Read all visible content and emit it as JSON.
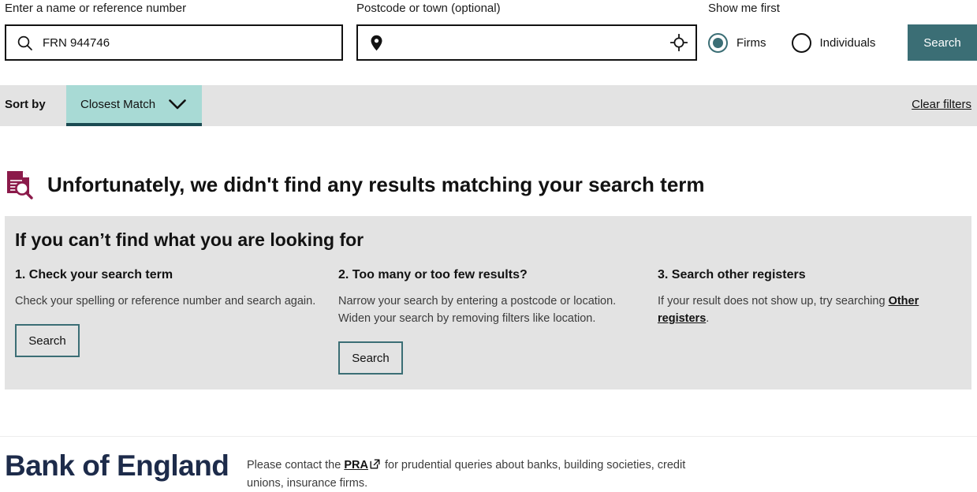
{
  "search_bar": {
    "name_field": {
      "label": "Enter a name or reference number",
      "value": "FRN 944746",
      "placeholder": "",
      "icon": "search-icon"
    },
    "postcode_field": {
      "label": "Postcode or town (optional)",
      "value": "",
      "placeholder": "",
      "left_icon": "map-pin-icon",
      "right_icon": "locate-crosshair-icon"
    },
    "show_me_first": {
      "label": "Show me first",
      "options": [
        {
          "label": "Firms",
          "selected": true
        },
        {
          "label": "Individuals",
          "selected": false
        }
      ]
    },
    "search_button": "Search"
  },
  "sort_bar": {
    "sort_by_label": "Sort by",
    "selected_sort": "Closest Match",
    "caret_icon": "chevron-down-icon",
    "clear_filters": "Clear filters"
  },
  "result": {
    "icon": "document-search-icon",
    "heading": "Unfortunately, we didn't find any results matching your search term"
  },
  "help_panel": {
    "title": "If you can’t find what you are looking for",
    "columns": [
      {
        "title": "1. Check your search term",
        "body": "Check your spelling or reference number and search again.",
        "button": "Search"
      },
      {
        "title": "2. Too many or too few results?",
        "body_line1": "Narrow your search by entering a postcode or location.",
        "body_line2": "Widen your search by removing filters like location.",
        "button": "Search"
      },
      {
        "title": "3. Search other registers",
        "body_prefix": "If your result does not show up, try searching ",
        "link_text": "Other registers",
        "body_suffix": "."
      }
    ]
  },
  "footer": {
    "logo": "Bank of England",
    "text_prefix": "Please contact the ",
    "link_text": "PRA",
    "link_icon": "external-link-icon",
    "text_suffix": " for prudential queries about banks, building societies, credit unions, insurance firms."
  },
  "colors": {
    "teal": "#3B6E75",
    "teal_dark": "#1B4B52",
    "teal_light": "#A8DAD5",
    "grey_panel": "#E3E3E3",
    "navy": "#1D2B4A",
    "maroon": "#8B1A4A"
  }
}
